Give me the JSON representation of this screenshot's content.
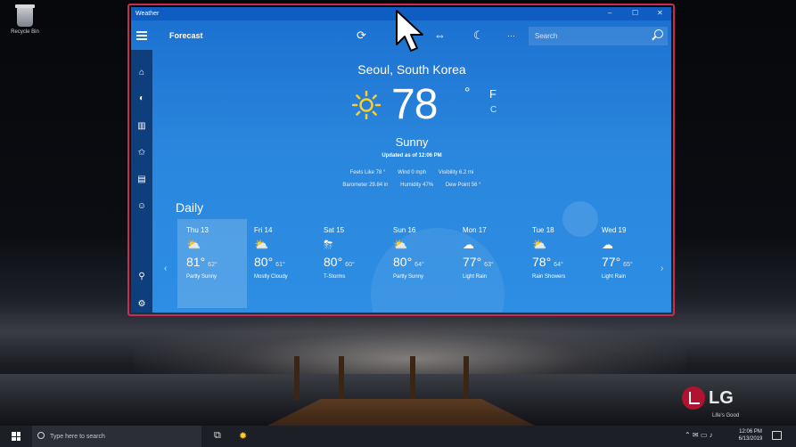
{
  "desktop": {
    "recycle_bin_label": "Recycle Bin",
    "lg_brand": "LG",
    "lg_tagline": "Life's Good"
  },
  "window": {
    "title": "Weather",
    "controls": {
      "minimize": "–",
      "maximize": "☐",
      "close": "✕"
    }
  },
  "toolbar": {
    "title": "Forecast",
    "search_placeholder": "Search",
    "more": "···"
  },
  "current": {
    "location": "Seoul, South Korea",
    "temperature": "78",
    "degree": "°",
    "unit_f": "F",
    "unit_c": "C",
    "condition": "Sunny",
    "updated": "Updated as of 12:06 PM",
    "feels_like": "Feels Like  78 °",
    "wind": "Wind   0 mph",
    "visibility": "Visibility   6.2 mi",
    "barometer": "Barometer   29.84 in",
    "humidity": "Humidity   47%",
    "dew_point": "Dew Point   56 °"
  },
  "daily": {
    "title": "Daily",
    "prev": "‹",
    "next": "›",
    "days": [
      {
        "name": "Thu 13",
        "icon": "partly-sunny-icon",
        "glyph": "⛅",
        "hi": "81°",
        "lo": "62°",
        "desc": "Partly Sunny"
      },
      {
        "name": "Fri 14",
        "icon": "mostly-cloudy-icon",
        "glyph": "⛅",
        "hi": "80°",
        "lo": "61°",
        "desc": "Mostly Cloudy"
      },
      {
        "name": "Sat 15",
        "icon": "t-storms-icon",
        "glyph": "⛈",
        "hi": "80°",
        "lo": "60°",
        "desc": "T-Storms"
      },
      {
        "name": "Sun 16",
        "icon": "partly-sunny-icon",
        "glyph": "⛅",
        "hi": "80°",
        "lo": "64°",
        "desc": "Partly Sunny"
      },
      {
        "name": "Mon 17",
        "icon": "light-rain-icon",
        "glyph": "☁",
        "hi": "77°",
        "lo": "63°",
        "desc": "Light Rain"
      },
      {
        "name": "Tue 18",
        "icon": "rain-showers-icon",
        "glyph": "⛅",
        "hi": "78°",
        "lo": "64°",
        "desc": "Rain Showers"
      },
      {
        "name": "Wed 19",
        "icon": "light-rain-icon",
        "glyph": "☁",
        "hi": "77°",
        "lo": "65°",
        "desc": "Light Rain"
      }
    ]
  },
  "taskbar": {
    "search_placeholder": "Type here to search",
    "clock_time": "12:06 PM",
    "clock_date": "6/13/2019"
  },
  "colors": {
    "app_blue": "#2a86dd",
    "titlebar": "#0f5cc2",
    "sidenav": "#0e3f7c",
    "highlight_frame": "#c72c55",
    "sun": "#ffcc2b"
  }
}
